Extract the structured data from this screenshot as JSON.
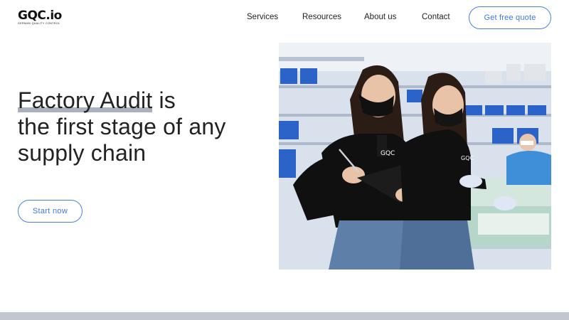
{
  "brand": {
    "name": "GQC.io",
    "tagline": "GERMAN QUALITY CONTROL"
  },
  "nav": {
    "items": [
      "Services",
      "Resources",
      "About us",
      "Contact"
    ],
    "cta_label": "Get free quote"
  },
  "hero": {
    "title_highlight": "Factory Audit",
    "title_rest_1": " is",
    "title_line_2": "the first stage of any",
    "title_line_3": "supply chain",
    "cta_label": "Start now"
  },
  "colors": {
    "accent": "#4a80e6",
    "highlight": "#8e96a8",
    "text": "#222222",
    "footer_band": "#c2c6cf"
  },
  "photo": {
    "logo_text": "GQC",
    "icon": "inspectors-photo"
  }
}
